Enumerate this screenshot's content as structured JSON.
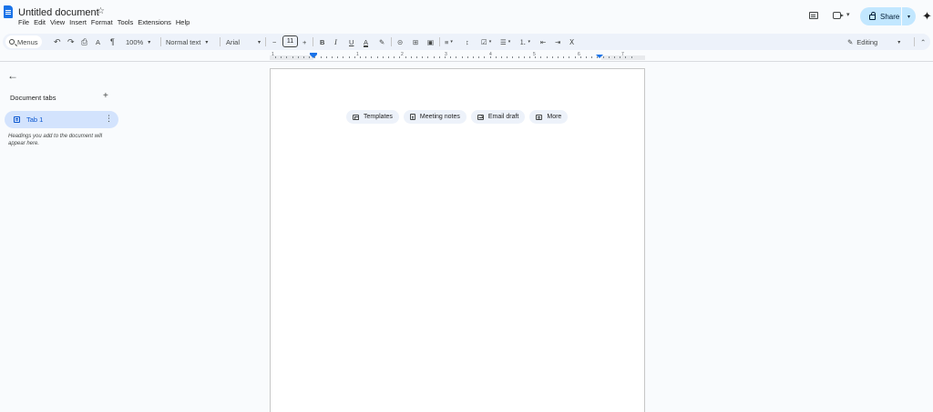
{
  "document": {
    "title": "Untitled document",
    "star": "☆"
  },
  "menu": [
    "File",
    "Edit",
    "View",
    "Insert",
    "Format",
    "Tools",
    "Extensions",
    "Help"
  ],
  "header": {
    "share_label": "Share",
    "share_caret": "▾",
    "meet_caret": "▾",
    "gemini_glyph": "✦"
  },
  "toolbar": {
    "menus_label": "Menus",
    "undo": "↶",
    "redo": "↷",
    "print": "⎙",
    "spellcheck": "A",
    "paint_format": "¶",
    "zoom": "100%",
    "caret": "▾",
    "style": "Normal text",
    "font": "Arial",
    "minus": "−",
    "font_size": "11",
    "plus": "+",
    "bold": "B",
    "italic": "I",
    "underline": "U",
    "text_color": "A",
    "highlight": "✎",
    "link": "⊝",
    "comment": "⊞",
    "image": "▣",
    "align": "≡",
    "line_spacing": "↕",
    "checklist": "☑",
    "bullets": "☰",
    "numbered": "⒈",
    "indent_less": "⇤",
    "indent_more": "⇥",
    "clear_format": "Ⅹ",
    "mode_label": "Editing",
    "mode_pencil": "✎",
    "collapse": "⌃"
  },
  "ruler": {
    "numbers": [
      "1",
      "1",
      "2",
      "3",
      "4",
      "5",
      "6",
      "7"
    ]
  },
  "sidebar": {
    "back": "←",
    "heading": "Document tabs",
    "add": "+",
    "tab_label": "Tab 1",
    "tab_more": "⋮",
    "hint": "Headings you add to the document will appear here."
  },
  "chips": [
    {
      "label": "Templates",
      "icon": "template-icon"
    },
    {
      "label": "Meeting notes",
      "icon": "document-icon"
    },
    {
      "label": "Email draft",
      "icon": "email-icon"
    },
    {
      "label": "More",
      "icon": "more-icon"
    }
  ],
  "colors": {
    "accent": "#1a73e8",
    "share_bg": "#c2e7ff",
    "toolbar_bg": "#edf2fa",
    "tab_selected_bg": "#d3e3fd"
  }
}
